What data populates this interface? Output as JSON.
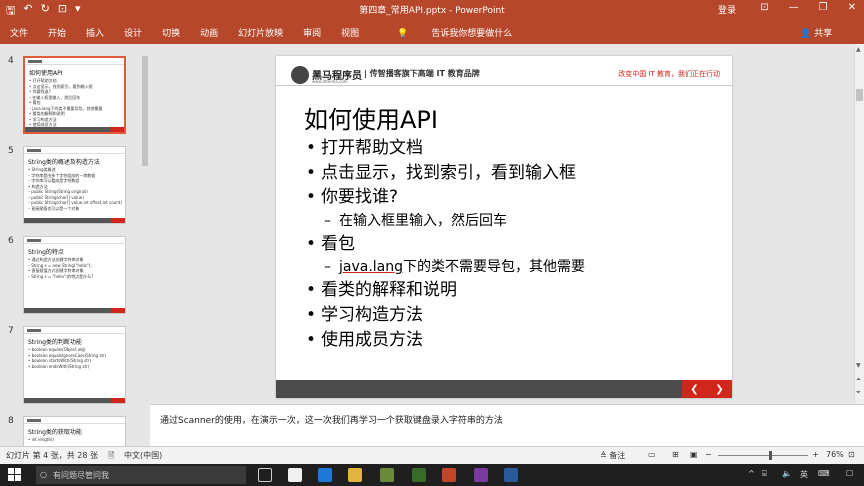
{
  "titlebar": {
    "doc_title": "第四章_常用API.pptx  -  PowerPoint",
    "login": "登录",
    "qat": {
      "save": "🖫",
      "undo": "↶",
      "redo": "↻",
      "present": "⊡",
      "more": "▾"
    },
    "window_controls": {
      "options": "⊡",
      "minimize": "—",
      "restore": "❐",
      "close": "✕"
    }
  },
  "ribbon": {
    "tabs": [
      "文件",
      "开始",
      "插入",
      "设计",
      "切换",
      "动画",
      "幻灯片放映",
      "审阅",
      "视图"
    ],
    "tell_me": "告诉我你想要做什么",
    "share": "共享",
    "collapse": "⌃"
  },
  "thumbnails": [
    {
      "num": "4",
      "title": "如何使用API",
      "lines": [
        "• 打开帮助文档",
        "• 点击显示，找到索引，看到输入框",
        "• 你要找谁?",
        "  – 在输入框里输入，然后回车",
        "• 看包",
        "  – java.lang下的类不需要导包，其他需要",
        "• 看类的解释和说明",
        "• 学习构造方法",
        "• 使用成员方法"
      ]
    },
    {
      "num": "5",
      "title": "String类的概述及构造方法",
      "lines": [
        "• String类概述",
        "  – 字符串是由多个字符组成的一串数据",
        "  – 字符串可以看成是字符数组",
        "• 构造方法",
        "  – public String(String original)",
        "  – public String(char[] value)",
        "  – public String(char[] value,int offset,int count)",
        "  – 直接赋值也可以是一个对象"
      ]
    },
    {
      "num": "6",
      "title": "String的特点",
      "lines": [
        "• 通过构造方法创建字符串对象",
        "  – String s = new String(\"hello\");",
        "• 直接赋值方式创建字符串对象",
        "  – String s = \"hello\";的特点是什么?"
      ]
    },
    {
      "num": "7",
      "title": "String类的判断功能",
      "lines": [
        "• boolean equals(Object obj)",
        "• boolean equalsIgnoreCase(String str)",
        "• boolean startsWith(String str)",
        "• boolean endsWith(String str)"
      ]
    },
    {
      "num": "8",
      "title": "String类的获取功能",
      "lines": [
        "• int length()"
      ]
    }
  ],
  "slide": {
    "brand": "黑马程序员",
    "brand_sub": "www.itheima.com",
    "header_slogan": "| 传智播客旗下高端 IT 教育品牌",
    "header_right": "改变中国 IT 教育，我们正在行动",
    "title": "如何使用API",
    "bullets": [
      {
        "level": 1,
        "text": "打开帮助文档"
      },
      {
        "level": 1,
        "text": "点击显示，找到索引，看到输入框"
      },
      {
        "level": 1,
        "text": "你要找谁?"
      },
      {
        "level": 2,
        "text": "在输入框里输入，然后回车"
      },
      {
        "level": 1,
        "text": "看包"
      },
      {
        "level": 2,
        "text_underlined": "java.lang",
        "text_rest": "下的类不需要导包，其他需要"
      },
      {
        "level": 1,
        "text": "看类的解释和说明"
      },
      {
        "level": 1,
        "text": "学习构造方法"
      },
      {
        "level": 1,
        "text": "使用成员方法"
      }
    ],
    "nav_prev": "❮",
    "nav_next": "❯"
  },
  "notes": "通过Scanner的使用，在演示一次，这一次我们再学习一个获取键盘录入字符串的方法",
  "statusbar": {
    "slide_info": "幻灯片 第 4 张，共 28 张",
    "language": "中文(中国)",
    "notes_btn": "≜ 备注",
    "zoom": "76%",
    "zoom_minus": "−",
    "zoom_plus": "+"
  },
  "taskbar": {
    "search_placeholder": "有问题尽管问我",
    "tray": {
      "up": "^",
      "ime": "英",
      "notify": "☐"
    }
  },
  "colors": {
    "accent": "#b7472a",
    "brand_red": "#d0261c",
    "footer_gray": "#4b4b4b"
  }
}
